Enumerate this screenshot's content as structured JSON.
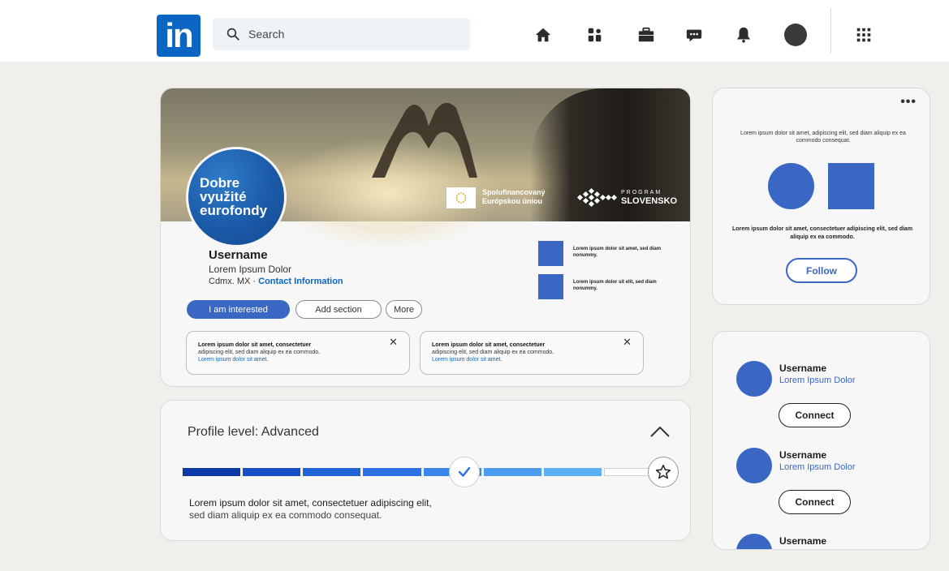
{
  "topbar": {
    "logo_text": "in",
    "search_placeholder": "Search",
    "nav_icons": [
      "home-icon",
      "network-icon",
      "jobs-icon",
      "messaging-icon",
      "notifications-icon",
      "profile-avatar",
      "apps-grid-icon"
    ]
  },
  "profile": {
    "badge_lines": [
      "Dobre",
      "využité",
      "eurofondy"
    ],
    "cover_eu_text_1": "Spolufinancovaný",
    "cover_eu_text_2": "Európskou úniou",
    "cover_program_small": "PROGRAM",
    "cover_program_big": "SLOVENSKO",
    "username": "Username",
    "subtitle": "Lorem Ipsum Dolor",
    "location": "Cdmx. MX",
    "location_separator": "·",
    "contact_link": "Contact Information",
    "buttons": {
      "interested": "I am interested",
      "add_section": "Add section",
      "more": "More"
    },
    "side_items": [
      {
        "text": "Lorem ipsum dolor sit amet, sed diam nonummy."
      },
      {
        "text": "Lorem ipsum dolor sit elit, sed diam nonummy."
      }
    ],
    "notices": [
      {
        "line1": "Lorem ipsum dolor sit amet, consectetuer",
        "line2": "adipiscing elit, sed diam aliquip ex ea commodo.",
        "link": "Lorem ipsum dolor sit amet."
      },
      {
        "line1": "Lorem ipsum dolor sit amet, consectetuer",
        "line2": "adipiscing elit, sed diam aliquip ex ea commodo.",
        "link": "Lorem ipsum dolor sit amet."
      }
    ]
  },
  "level": {
    "title": "Profile level: Advanced",
    "progress_segments": [
      "#0b3aa8",
      "#1650c4",
      "#1f63d6",
      "#2f6fe4",
      "#3b86ea",
      "#4c9df0",
      "#5ab0f3",
      "#ffffff"
    ],
    "progress_completed_fraction": 0.5,
    "desc_line1": "Lorem ipsum dolor sit amet, consectetuer adipiscing elit,",
    "desc_line2": "sed diam aliquip ex ea commodo consequat."
  },
  "ad": {
    "text": "Lorem ipsum dolor sit amet, adipiscing elit, sed diam aliquip ex ea commodo consequat.",
    "text2": "Lorem ipsum dolor sit amet, consectetuer adipiscing elit, sed diam aliquip ex ea commodo.",
    "follow": "Follow"
  },
  "people": [
    {
      "name": "Username",
      "subtitle": "Lorem Ipsum Dolor",
      "connect": "Connect"
    },
    {
      "name": "Username",
      "subtitle": "Lorem Ipsum Dolor",
      "connect": "Connect"
    },
    {
      "name": "Username"
    }
  ],
  "colors": {
    "accent": "#3a66c4",
    "brand": "#0a66c2",
    "background": "#f0efeb"
  }
}
